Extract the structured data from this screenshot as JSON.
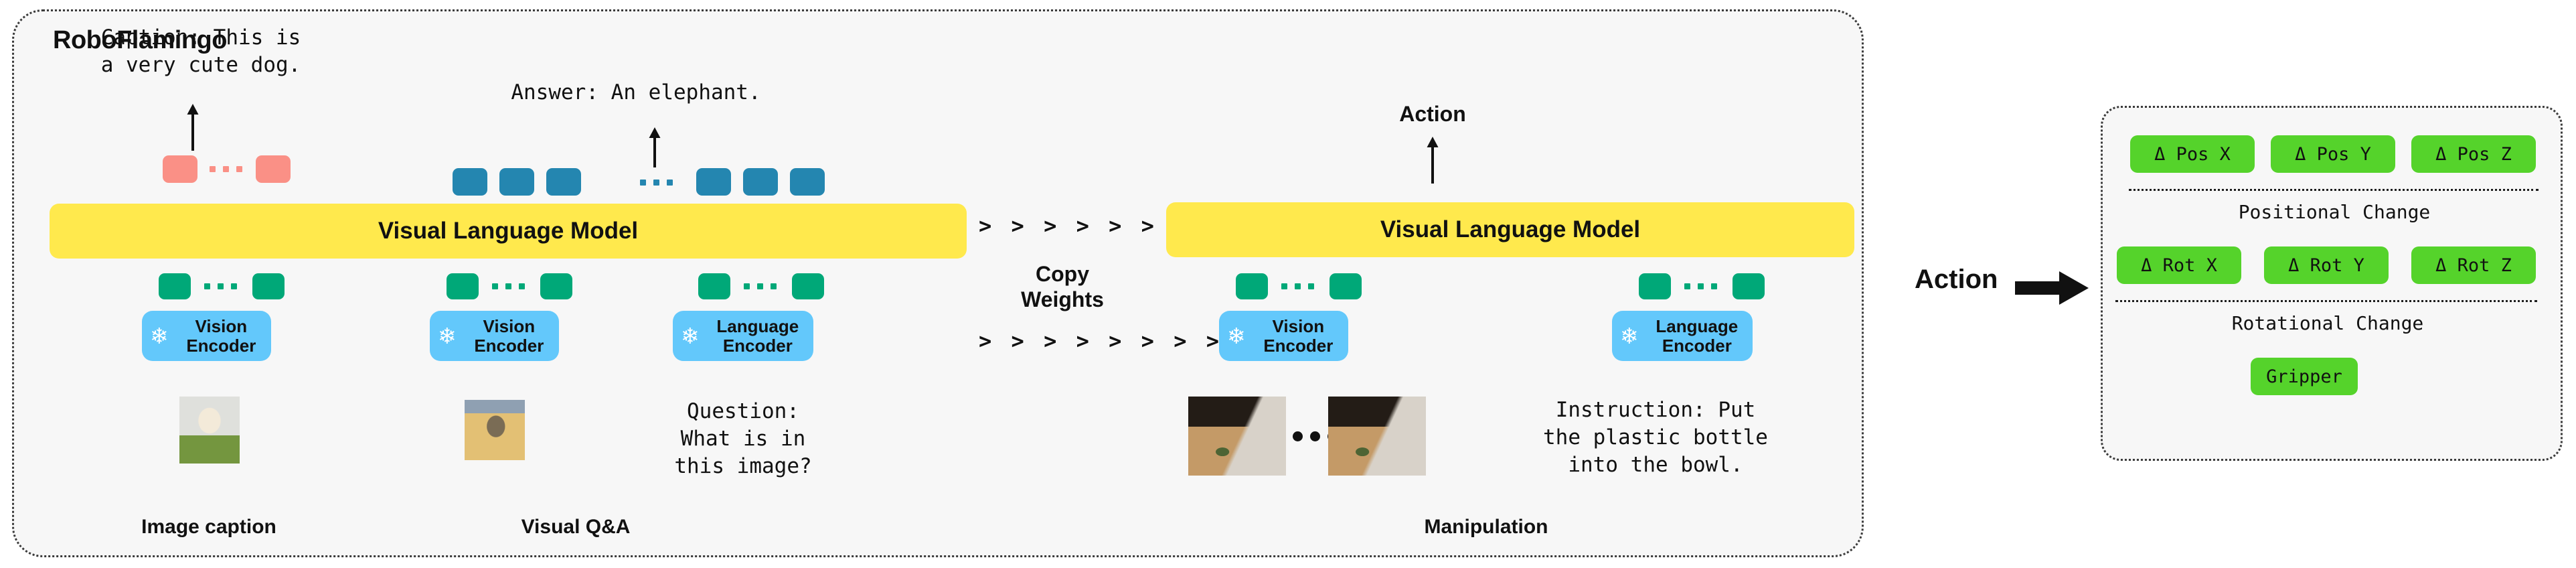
{
  "panel": {
    "title": "RoboFlamingo"
  },
  "stages": {
    "image_caption": {
      "caption_text": "Caption: This is\na very cute dog.",
      "encoder_label": "Vision\nEncoder",
      "snowflake_icon": "❄",
      "caption_label": "Image caption",
      "image_alt": "dog-photo"
    },
    "visual_qa": {
      "answer_text": "Answer: An elephant.",
      "vision_encoder_label": "Vision\nEncoder",
      "language_encoder_label": "Language\nEncoder",
      "question_text": "Question:\nWhat is in\nthis image?",
      "caption_label": "Visual Q&A",
      "image_alt": "elephant-photo"
    },
    "manipulation": {
      "action_text": "Action",
      "vision_encoder_label": "Vision\nEncoder",
      "language_encoder_label": "Language\nEncoder",
      "instruction_text": "Instruction: Put\nthe plastic bottle\ninto the bowl.",
      "caption_label": "Manipulation",
      "image_alt": "robot-arm-photo"
    }
  },
  "vlm": {
    "left_label": "Visual Language Model",
    "right_label": "Visual Language Model"
  },
  "copy_weights": {
    "chevrons_top": "> > > > > > > > >",
    "label": "Copy\nWeights",
    "label_line1": "Copy",
    "label_line2": "Weights",
    "chevrons_bottom": "> > > > > > > > >"
  },
  "action_out": {
    "label": "Action",
    "arrow_icon": "right-arrow",
    "pos_chips": [
      "Δ Pos X",
      "Δ Pos Y",
      "Δ Pos Z"
    ],
    "pos_group_label": "Positional Change",
    "rot_chips": [
      "Δ Rot X",
      "Δ Rot Y",
      "Δ Rot Z"
    ],
    "rot_group_label": "Rotational Change",
    "gripper_chip": "Gripper"
  },
  "colors": {
    "panel_bg": "#f7f7f7",
    "vlm_yellow": "#ffe94d",
    "encoder_blue": "#63c8fb",
    "token_pink": "#fa9086",
    "token_blue": "#2486b0",
    "token_green": "#00a878",
    "action_green": "#55d32b"
  }
}
